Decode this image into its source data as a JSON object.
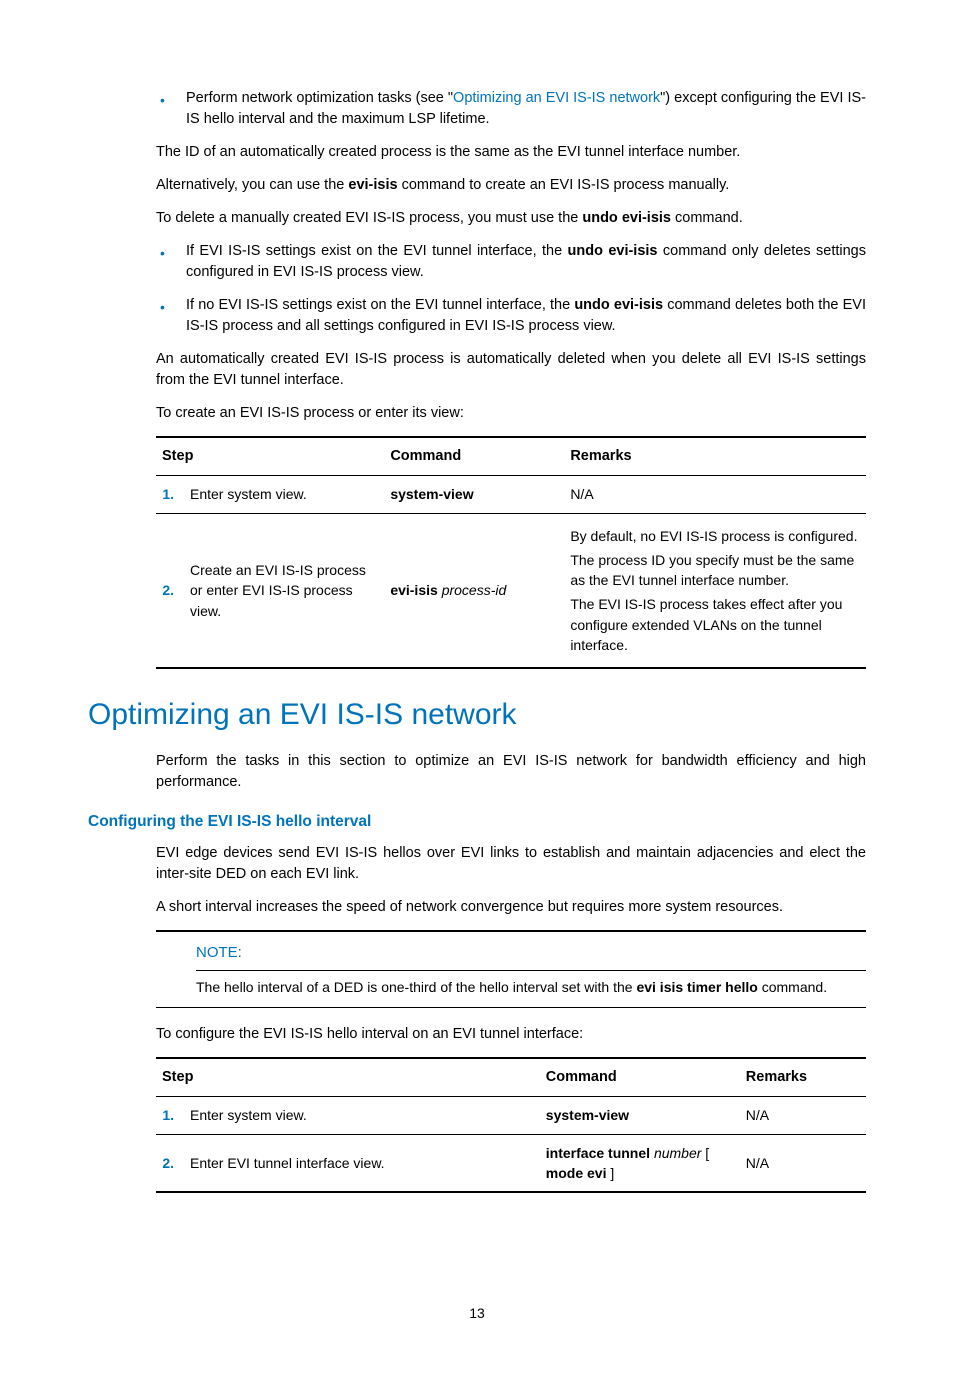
{
  "bullets1": {
    "b1_pre": "Perform network optimization tasks (see \"",
    "b1_link": "Optimizing an EVI IS-IS network",
    "b1_post": "\") except configuring the EVI IS-IS hello interval and the maximum LSP lifetime."
  },
  "p1": "The ID of an automatically created process is the same as the EVI tunnel interface number.",
  "p2_pre": "Alternatively, you can use the ",
  "p2_b": "evi-isis",
  "p2_post": " command to create an EVI IS-IS process manually.",
  "p3_pre": "To delete a manually created EVI IS-IS process, you must use the ",
  "p3_b": "undo evi-isis",
  "p3_post": " command.",
  "bullets2": {
    "b1_pre": "If EVI IS-IS settings exist on the EVI tunnel interface, the ",
    "b1_b": "undo evi-isis",
    "b1_post": " command only deletes settings configured in EVI IS-IS process view.",
    "b2_pre": "If no EVI IS-IS settings exist on the EVI tunnel interface, the ",
    "b2_b": "undo evi-isis",
    "b2_post": " command deletes both the EVI IS-IS process and all settings configured in EVI IS-IS process view."
  },
  "p4": "An automatically created EVI IS-IS process is automatically deleted when you delete all EVI IS-IS settings from the EVI tunnel interface.",
  "p5": "To create an EVI IS-IS process or enter its view:",
  "table1": {
    "h1": "Step",
    "h2": "Command",
    "h3": "Remarks",
    "r1": {
      "num": "1.",
      "step": "Enter system view.",
      "cmd": "system-view",
      "rem": "N/A"
    },
    "r2": {
      "num": "2.",
      "step": "Create an EVI IS-IS process or enter EVI IS-IS process view.",
      "cmd_b": "evi-isis ",
      "cmd_i": "process-id",
      "rem1": "By default, no EVI IS-IS process is configured.",
      "rem2": "The process ID you specify must be the same as the EVI tunnel interface number.",
      "rem3": "The EVI IS-IS process takes effect after you configure extended VLANs on the tunnel interface."
    }
  },
  "h1": "Optimizing an EVI IS-IS network",
  "p6": "Perform the tasks in this section to optimize an EVI IS-IS network for bandwidth efficiency and high performance.",
  "h3a": "Configuring the EVI IS-IS hello interval",
  "p7": "EVI edge devices send EVI IS-IS hellos over EVI links to establish and maintain adjacencies and elect the inter-site DED on each EVI link.",
  "p8": "A short interval increases the speed of network convergence but requires more system resources.",
  "note": {
    "title": "NOTE:",
    "body_pre": "The hello interval of a DED is one-third of the hello interval set with the ",
    "body_b": "evi isis timer hello",
    "body_post": " command."
  },
  "p9": "To configure the EVI IS-IS hello interval on an EVI tunnel interface:",
  "table2": {
    "h1": "Step",
    "h2": "Command",
    "h3": "Remarks",
    "r1": {
      "num": "1.",
      "step": "Enter system view.",
      "cmd": "system-view",
      "rem": "N/A"
    },
    "r2": {
      "num": "2.",
      "step": "Enter EVI tunnel interface view.",
      "cmd_b1": "interface tunnel ",
      "cmd_i": "number",
      "cmd_mid": " [ ",
      "cmd_b2": "mode evi",
      "cmd_post": " ]",
      "rem": "N/A"
    }
  },
  "pagenum": "13"
}
